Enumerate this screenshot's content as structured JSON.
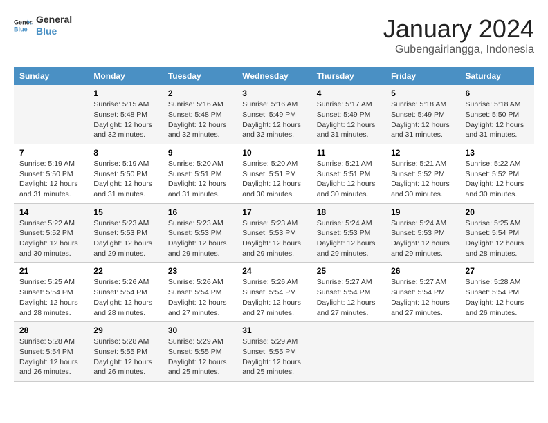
{
  "header": {
    "logo_line1": "General",
    "logo_line2": "Blue",
    "month_title": "January 2024",
    "location": "Gubengairlangga, Indonesia"
  },
  "calendar": {
    "days_of_week": [
      "Sunday",
      "Monday",
      "Tuesday",
      "Wednesday",
      "Thursday",
      "Friday",
      "Saturday"
    ],
    "weeks": [
      [
        {
          "day": "",
          "info": ""
        },
        {
          "day": "1",
          "info": "Sunrise: 5:15 AM\nSunset: 5:48 PM\nDaylight: 12 hours\nand 32 minutes."
        },
        {
          "day": "2",
          "info": "Sunrise: 5:16 AM\nSunset: 5:48 PM\nDaylight: 12 hours\nand 32 minutes."
        },
        {
          "day": "3",
          "info": "Sunrise: 5:16 AM\nSunset: 5:49 PM\nDaylight: 12 hours\nand 32 minutes."
        },
        {
          "day": "4",
          "info": "Sunrise: 5:17 AM\nSunset: 5:49 PM\nDaylight: 12 hours\nand 31 minutes."
        },
        {
          "day": "5",
          "info": "Sunrise: 5:18 AM\nSunset: 5:49 PM\nDaylight: 12 hours\nand 31 minutes."
        },
        {
          "day": "6",
          "info": "Sunrise: 5:18 AM\nSunset: 5:50 PM\nDaylight: 12 hours\nand 31 minutes."
        }
      ],
      [
        {
          "day": "7",
          "info": "Sunrise: 5:19 AM\nSunset: 5:50 PM\nDaylight: 12 hours\nand 31 minutes."
        },
        {
          "day": "8",
          "info": "Sunrise: 5:19 AM\nSunset: 5:50 PM\nDaylight: 12 hours\nand 31 minutes."
        },
        {
          "day": "9",
          "info": "Sunrise: 5:20 AM\nSunset: 5:51 PM\nDaylight: 12 hours\nand 31 minutes."
        },
        {
          "day": "10",
          "info": "Sunrise: 5:20 AM\nSunset: 5:51 PM\nDaylight: 12 hours\nand 30 minutes."
        },
        {
          "day": "11",
          "info": "Sunrise: 5:21 AM\nSunset: 5:51 PM\nDaylight: 12 hours\nand 30 minutes."
        },
        {
          "day": "12",
          "info": "Sunrise: 5:21 AM\nSunset: 5:52 PM\nDaylight: 12 hours\nand 30 minutes."
        },
        {
          "day": "13",
          "info": "Sunrise: 5:22 AM\nSunset: 5:52 PM\nDaylight: 12 hours\nand 30 minutes."
        }
      ],
      [
        {
          "day": "14",
          "info": "Sunrise: 5:22 AM\nSunset: 5:52 PM\nDaylight: 12 hours\nand 30 minutes."
        },
        {
          "day": "15",
          "info": "Sunrise: 5:23 AM\nSunset: 5:53 PM\nDaylight: 12 hours\nand 29 minutes."
        },
        {
          "day": "16",
          "info": "Sunrise: 5:23 AM\nSunset: 5:53 PM\nDaylight: 12 hours\nand 29 minutes."
        },
        {
          "day": "17",
          "info": "Sunrise: 5:23 AM\nSunset: 5:53 PM\nDaylight: 12 hours\nand 29 minutes."
        },
        {
          "day": "18",
          "info": "Sunrise: 5:24 AM\nSunset: 5:53 PM\nDaylight: 12 hours\nand 29 minutes."
        },
        {
          "day": "19",
          "info": "Sunrise: 5:24 AM\nSunset: 5:53 PM\nDaylight: 12 hours\nand 29 minutes."
        },
        {
          "day": "20",
          "info": "Sunrise: 5:25 AM\nSunset: 5:54 PM\nDaylight: 12 hours\nand 28 minutes."
        }
      ],
      [
        {
          "day": "21",
          "info": "Sunrise: 5:25 AM\nSunset: 5:54 PM\nDaylight: 12 hours\nand 28 minutes."
        },
        {
          "day": "22",
          "info": "Sunrise: 5:26 AM\nSunset: 5:54 PM\nDaylight: 12 hours\nand 28 minutes."
        },
        {
          "day": "23",
          "info": "Sunrise: 5:26 AM\nSunset: 5:54 PM\nDaylight: 12 hours\nand 27 minutes."
        },
        {
          "day": "24",
          "info": "Sunrise: 5:26 AM\nSunset: 5:54 PM\nDaylight: 12 hours\nand 27 minutes."
        },
        {
          "day": "25",
          "info": "Sunrise: 5:27 AM\nSunset: 5:54 PM\nDaylight: 12 hours\nand 27 minutes."
        },
        {
          "day": "26",
          "info": "Sunrise: 5:27 AM\nSunset: 5:54 PM\nDaylight: 12 hours\nand 27 minutes."
        },
        {
          "day": "27",
          "info": "Sunrise: 5:28 AM\nSunset: 5:54 PM\nDaylight: 12 hours\nand 26 minutes."
        }
      ],
      [
        {
          "day": "28",
          "info": "Sunrise: 5:28 AM\nSunset: 5:54 PM\nDaylight: 12 hours\nand 26 minutes."
        },
        {
          "day": "29",
          "info": "Sunrise: 5:28 AM\nSunset: 5:55 PM\nDaylight: 12 hours\nand 26 minutes."
        },
        {
          "day": "30",
          "info": "Sunrise: 5:29 AM\nSunset: 5:55 PM\nDaylight: 12 hours\nand 25 minutes."
        },
        {
          "day": "31",
          "info": "Sunrise: 5:29 AM\nSunset: 5:55 PM\nDaylight: 12 hours\nand 25 minutes."
        },
        {
          "day": "",
          "info": ""
        },
        {
          "day": "",
          "info": ""
        },
        {
          "day": "",
          "info": ""
        }
      ]
    ]
  }
}
